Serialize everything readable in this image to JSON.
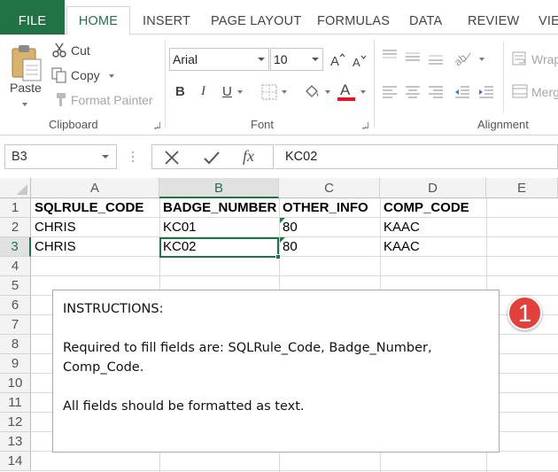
{
  "ribbon": {
    "tabs": [
      "FILE",
      "HOME",
      "INSERT",
      "PAGE LAYOUT",
      "FORMULAS",
      "DATA",
      "REVIEW",
      "VIE"
    ],
    "active_tab": "HOME",
    "clipboard": {
      "group_label": "Clipboard",
      "paste": "Paste",
      "cut": "Cut",
      "copy": "Copy",
      "format_painter": "Format Painter"
    },
    "font": {
      "group_label": "Font",
      "font_name": "Arial",
      "font_size": "10",
      "bold": "B",
      "italic": "I",
      "underline": "U",
      "font_color_letter": "A",
      "font_color": "#e81123"
    },
    "alignment": {
      "group_label": "Alignment",
      "wrap_text": "Wrap",
      "merge": "Merg"
    }
  },
  "formula_bar": {
    "name_box": "B3",
    "fx_label": "fx",
    "value": "KC02"
  },
  "sheet": {
    "columns": [
      "A",
      "B",
      "C",
      "D",
      "E"
    ],
    "selected_column": "B",
    "rows": [
      "1",
      "2",
      "3",
      "4",
      "5",
      "6",
      "7",
      "8",
      "9",
      "10",
      "11",
      "12",
      "13",
      "14"
    ],
    "selected_row": "3",
    "cells": [
      [
        "SQLRULE_CODE",
        "BADGE_NUMBER",
        "OTHER_INFO",
        "COMP_CODE",
        ""
      ],
      [
        "CHRIS",
        "KC01",
        "80",
        "KAAC",
        ""
      ],
      [
        "CHRIS",
        "KC02",
        "80",
        "KAAC",
        ""
      ]
    ]
  },
  "note": {
    "title": "INSTRUCTIONS:",
    "line1": "Required to fill fields are: SQLRule_Code, Badge_Number,",
    "line2": "Comp_Code.",
    "line3": "All fields should be formatted as text."
  },
  "badge": {
    "number": "1",
    "color": "#e2403a"
  },
  "colors": {
    "accent": "#217346"
  }
}
